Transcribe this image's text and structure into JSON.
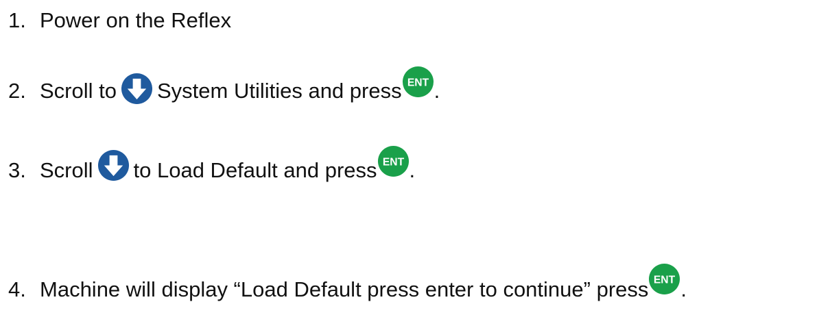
{
  "steps": [
    {
      "number": "1.",
      "text": "Power on the Reflex"
    },
    {
      "number": "2.",
      "before": "Scroll to",
      "middle": "System Utilities and press",
      "end": "."
    },
    {
      "number": "3.",
      "before": "Scroll",
      "middle": "to Load Default and press",
      "end": "."
    },
    {
      "number": "4.",
      "before": "Machine will display “Load Default press enter to continue” press",
      "end": "."
    }
  ],
  "icons": {
    "down_arrow": {
      "name": "down-arrow-icon",
      "color": "#1f5a9e"
    },
    "enter": {
      "name": "ent-icon",
      "label": "ENT",
      "color": "#1aa04a"
    }
  }
}
